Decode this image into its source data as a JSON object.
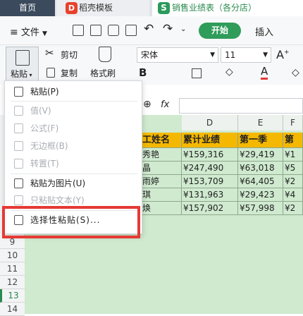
{
  "tabs": [
    {
      "label": "首页"
    },
    {
      "label": "稻壳模板"
    },
    {
      "label": "销售业绩表（各分店）"
    }
  ],
  "menu": {
    "file_label": "文件",
    "start_label": "开始",
    "insert_label": "插入"
  },
  "ribbon": {
    "paste_label": "粘贴",
    "cut_label": "剪切",
    "copy_label": "复制",
    "format_painter_label": "格式刷",
    "font_name": "宋体",
    "font_size": "11",
    "fx_label": "fx"
  },
  "paste_menu": {
    "items": [
      {
        "label": "粘贴(P)",
        "enabled": true
      },
      {
        "label": "值(V)",
        "enabled": false
      },
      {
        "label": "公式(F)",
        "enabled": false
      },
      {
        "label": "无边框(B)",
        "enabled": false
      },
      {
        "label": "转置(T)",
        "enabled": false
      },
      {
        "label": "粘贴为图片(U)",
        "enabled": true
      },
      {
        "label": "只粘贴文本(Y)",
        "enabled": false
      },
      {
        "label": "选择性粘贴(S)...",
        "enabled": true
      }
    ]
  },
  "sheet": {
    "columns": [
      "D",
      "E",
      "F"
    ],
    "header_row": [
      "工姓名",
      "累计业绩",
      "第一季",
      "第"
    ],
    "rows": [
      [
        "秀艳",
        "¥159,316",
        "¥29,419",
        "¥1"
      ],
      [
        "晶",
        "¥247,490",
        "¥63,018",
        "¥5"
      ],
      [
        "雨婷",
        "¥153,709",
        "¥64,405",
        "¥2"
      ],
      [
        "琪",
        "¥131,963",
        "¥29,423",
        "¥4"
      ],
      [
        "焕",
        "¥157,902",
        "¥57,998",
        "¥2"
      ]
    ],
    "row_numbers": [
      "9",
      "10",
      "11",
      "12",
      "13",
      "14"
    ]
  },
  "colors": {
    "header_fill": "#f5b800",
    "sheet_bg": "#cfeacf",
    "accent_green": "#2f9c5a",
    "highlight_red": "#e53a35"
  }
}
